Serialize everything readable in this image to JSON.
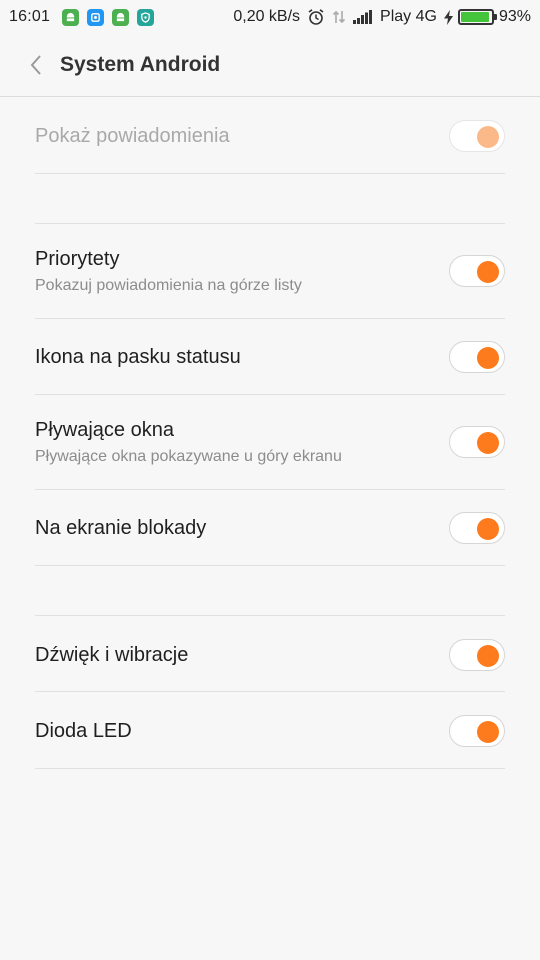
{
  "status_bar": {
    "time": "16:01",
    "speed": "0,20 kB/s",
    "carrier": "Play 4G",
    "battery_percent": "93%",
    "battery_level": 0.93,
    "notification_icons": [
      {
        "name": "android-notif-icon",
        "color": "#4caf50"
      },
      {
        "name": "cleaner-notif-icon",
        "color": "#2196f3"
      },
      {
        "name": "android-notif-icon",
        "color": "#4caf50"
      },
      {
        "name": "shield-notif-icon",
        "color": "#26a69a"
      }
    ]
  },
  "header": {
    "title": "System Android",
    "back_icon": "chevron-left-icon"
  },
  "settings": {
    "show_notifications": {
      "label": "Pokaż powiadomienia",
      "enabled": false,
      "on": true
    },
    "priority": {
      "label": "Priorytety",
      "sub": "Pokazuj powiadomienia na górze listy",
      "on": true
    },
    "status_bar_icon": {
      "label": "Ikona na pasku statusu",
      "on": true
    },
    "floating_windows": {
      "label": "Pływające okna",
      "sub": "Pływające okna pokazywane u góry ekranu",
      "on": true
    },
    "lock_screen": {
      "label": "Na ekranie blokady",
      "on": true
    },
    "sound_vibration": {
      "label": "Dźwięk i wibracje",
      "on": true
    },
    "led": {
      "label": "Dioda LED",
      "on": true
    }
  },
  "colors": {
    "accent": "#fd7b1d",
    "accent_disabled": "#fbb98a",
    "battery": "#43c43a"
  }
}
